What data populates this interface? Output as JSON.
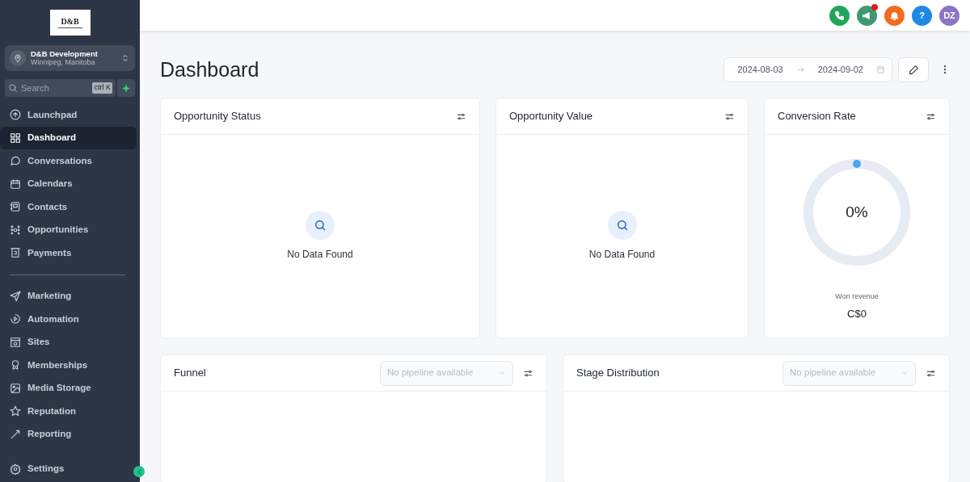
{
  "sidebar": {
    "logo": {
      "title": "D&B"
    },
    "account": {
      "name": "D&B Development",
      "location": "Winnipeg, Manitoba"
    },
    "search": {
      "placeholder": "Search",
      "shortcut": "ctrl K"
    },
    "groups": [
      [
        {
          "label": "Launchpad",
          "selected": false
        },
        {
          "label": "Dashboard",
          "selected": true
        },
        {
          "label": "Conversations",
          "selected": false
        },
        {
          "label": "Calendars",
          "selected": false
        },
        {
          "label": "Contacts",
          "selected": false
        },
        {
          "label": "Opportunities",
          "selected": false
        },
        {
          "label": "Payments",
          "selected": false
        }
      ],
      [
        {
          "label": "Marketing",
          "selected": false
        },
        {
          "label": "Automation",
          "selected": false
        },
        {
          "label": "Sites",
          "selected": false
        },
        {
          "label": "Memberships",
          "selected": false
        },
        {
          "label": "Media Storage",
          "selected": false
        },
        {
          "label": "Reputation",
          "selected": false
        },
        {
          "label": "Reporting",
          "selected": false
        }
      ]
    ],
    "settings": {
      "label": "Settings"
    }
  },
  "topbar": {
    "buttons": [
      {
        "kind": "phone",
        "color": "#22a55a",
        "notify": false
      },
      {
        "kind": "megaphone",
        "color": "#3e9a6e",
        "notify": true
      },
      {
        "kind": "bell",
        "color": "#f26b1d",
        "notify": false
      },
      {
        "kind": "help",
        "color": "#1e88e5",
        "notify": false,
        "text": "?"
      },
      {
        "kind": "avatar",
        "color": "#8a76c4",
        "notify": false,
        "text": "DZ"
      }
    ]
  },
  "page": {
    "title": "Dashboard",
    "date_from": "2024-08-03",
    "date_to": "2024-09-02"
  },
  "widgets": [
    {
      "title": "Opportunity Status",
      "kind": "empty",
      "message": "No Data Found"
    },
    {
      "title": "Opportunity Value",
      "kind": "empty",
      "message": "No Data Found"
    },
    {
      "title": "Conversion Rate",
      "kind": "gauge",
      "reading": "0%",
      "caption": "Won revenue",
      "amount": "C$0"
    },
    {
      "title": "Funnel",
      "kind": "pipeline",
      "placeholder": "No pipeline available"
    },
    {
      "title": "Stage Distribution",
      "kind": "pipeline",
      "placeholder": "No pipeline available"
    }
  ]
}
